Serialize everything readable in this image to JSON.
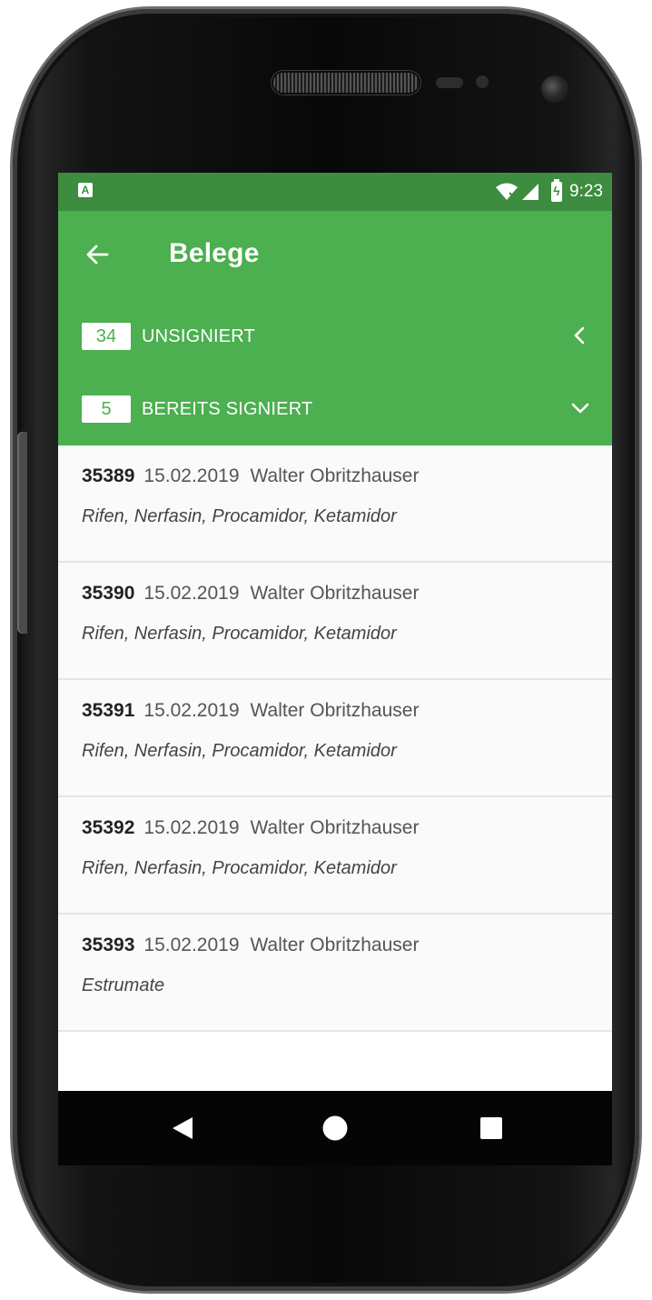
{
  "status_bar": {
    "time": "9:23",
    "notification_icon": "A"
  },
  "app_bar": {
    "title": "Belege"
  },
  "sections": [
    {
      "count": "34",
      "label": "UNSIGNIERT",
      "chevron": "chevron-left-icon"
    },
    {
      "count": "5",
      "label": "BEREITS SIGNIERT",
      "chevron": "chevron-down-icon"
    }
  ],
  "belege": [
    {
      "id": "35389",
      "date": "15.02.2019",
      "person": "Walter Obritzhauser",
      "items": "Rifen, Nerfasin, Procamidor, Ketamidor"
    },
    {
      "id": "35390",
      "date": "15.02.2019",
      "person": "Walter Obritzhauser",
      "items": "Rifen, Nerfasin, Procamidor, Ketamidor"
    },
    {
      "id": "35391",
      "date": "15.02.2019",
      "person": "Walter Obritzhauser",
      "items": "Rifen, Nerfasin, Procamidor, Ketamidor"
    },
    {
      "id": "35392",
      "date": "15.02.2019",
      "person": "Walter Obritzhauser",
      "items": "Rifen, Nerfasin, Procamidor, Ketamidor"
    },
    {
      "id": "35393",
      "date": "15.02.2019",
      "person": "Walter Obritzhauser",
      "items": "Estrumate"
    }
  ],
  "colors": {
    "primary": "#4caf50",
    "status_bar": "#3d8c40",
    "nav_bar": "#050505"
  }
}
